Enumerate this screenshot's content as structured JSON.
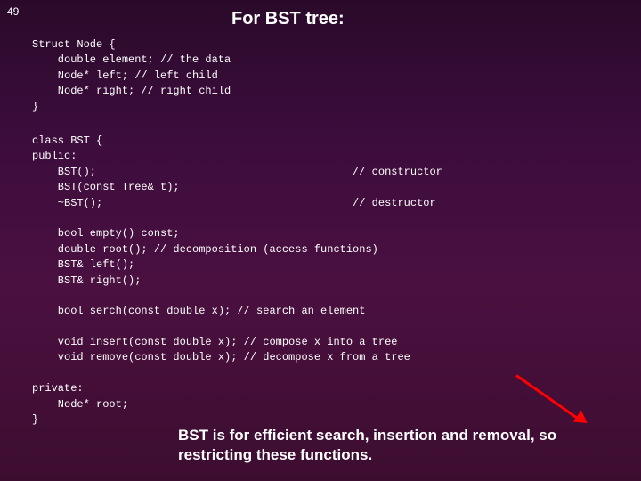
{
  "slide": {
    "number": "49",
    "title": "For BST tree:"
  },
  "code": {
    "struct": "Struct Node {\n    double element; // the data\n    Node* left; // left child\n    Node* right; // right child\n}",
    "class": "class BST {\npublic:\n    BST();                                        // constructor\n    BST(const Tree& t);\n    ~BST();                                       // destructor\n\n    bool empty() const;\n    double root(); // decomposition (access functions)\n    BST& left();\n    BST& right();\n\n    bool serch(const double x); // search an element\n\n    void insert(const double x); // compose x into a tree\n    void remove(const double x); // decompose x from a tree\n\nprivate:\n    Node* root;\n}"
  },
  "footer": "BST is for efficient search, insertion and removal, so restricting these functions."
}
